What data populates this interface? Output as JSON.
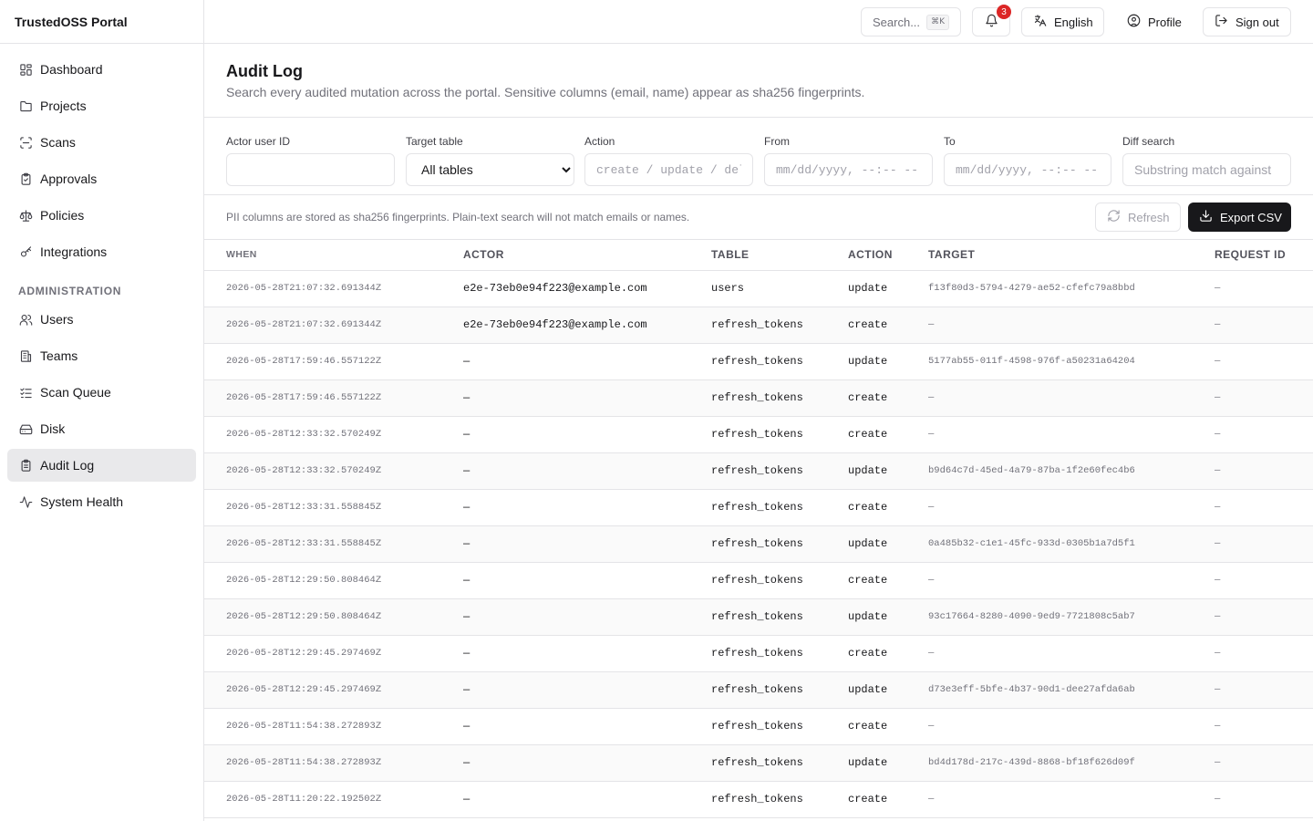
{
  "app": {
    "title": "TrustedOSS Portal"
  },
  "sidebar": {
    "items": [
      {
        "label": "Dashboard",
        "icon": "dashboard-icon"
      },
      {
        "label": "Projects",
        "icon": "folder-icon"
      },
      {
        "label": "Scans",
        "icon": "scan-icon"
      },
      {
        "label": "Approvals",
        "icon": "clipboard-check-icon"
      },
      {
        "label": "Policies",
        "icon": "scale-icon"
      },
      {
        "label": "Integrations",
        "icon": "key-icon"
      }
    ],
    "admin_section": "ADMINISTRATION",
    "admin_items": [
      {
        "label": "Users",
        "icon": "users-icon"
      },
      {
        "label": "Teams",
        "icon": "building-icon"
      },
      {
        "label": "Scan Queue",
        "icon": "list-check-icon"
      },
      {
        "label": "Disk",
        "icon": "hard-drive-icon"
      },
      {
        "label": "Audit Log",
        "icon": "clipboard-list-icon",
        "active": true
      },
      {
        "label": "System Health",
        "icon": "activity-icon"
      }
    ]
  },
  "topbar": {
    "search_label": "Search...",
    "search_shortcut": "⌘K",
    "notification_count": "3",
    "language": "English",
    "profile": "Profile",
    "sign_out": "Sign out"
  },
  "page": {
    "title": "Audit Log",
    "subtitle": "Search every audited mutation across the portal. Sensitive columns (email, name) appear as sha256 fingerprints."
  },
  "filters": {
    "actor_label": "Actor user ID",
    "actor_value": "",
    "table_label": "Target table",
    "table_value": "All tables",
    "action_label": "Action",
    "action_placeholder": "create / update / delete",
    "from_label": "From",
    "from_placeholder": "mm/dd/yyyy, --:-- --",
    "to_label": "To",
    "to_placeholder": "mm/dd/yyyy, --:-- --",
    "diff_label": "Diff search",
    "diff_placeholder": "Substring match against"
  },
  "toolbar": {
    "notice": "PII columns are stored as sha256 fingerprints. Plain-text search will not match emails or names.",
    "refresh": "Refresh",
    "export": "Export CSV"
  },
  "table": {
    "columns": [
      "WHEN",
      "ACTOR",
      "TABLE",
      "ACTION",
      "TARGET",
      "REQUEST ID"
    ],
    "rows": [
      [
        "2026-05-28T21:07:32.691344Z",
        "e2e-73eb0e94f223@example.com",
        "users",
        "update",
        "f13f80d3-5794-4279-ae52-cfefc79a8bbd",
        "—"
      ],
      [
        "2026-05-28T21:07:32.691344Z",
        "e2e-73eb0e94f223@example.com",
        "refresh_tokens",
        "create",
        "—",
        "—"
      ],
      [
        "2026-05-28T17:59:46.557122Z",
        "—",
        "refresh_tokens",
        "update",
        "5177ab55-011f-4598-976f-a50231a64204",
        "—"
      ],
      [
        "2026-05-28T17:59:46.557122Z",
        "—",
        "refresh_tokens",
        "create",
        "—",
        "—"
      ],
      [
        "2026-05-28T12:33:32.570249Z",
        "—",
        "refresh_tokens",
        "create",
        "—",
        "—"
      ],
      [
        "2026-05-28T12:33:32.570249Z",
        "—",
        "refresh_tokens",
        "update",
        "b9d64c7d-45ed-4a79-87ba-1f2e60fec4b6",
        "—"
      ],
      [
        "2026-05-28T12:33:31.558845Z",
        "—",
        "refresh_tokens",
        "create",
        "—",
        "—"
      ],
      [
        "2026-05-28T12:33:31.558845Z",
        "—",
        "refresh_tokens",
        "update",
        "0a485b32-c1e1-45fc-933d-0305b1a7d5f1",
        "—"
      ],
      [
        "2026-05-28T12:29:50.808464Z",
        "—",
        "refresh_tokens",
        "create",
        "—",
        "—"
      ],
      [
        "2026-05-28T12:29:50.808464Z",
        "—",
        "refresh_tokens",
        "update",
        "93c17664-8280-4090-9ed9-7721808c5ab7",
        "—"
      ],
      [
        "2026-05-28T12:29:45.297469Z",
        "—",
        "refresh_tokens",
        "create",
        "—",
        "—"
      ],
      [
        "2026-05-28T12:29:45.297469Z",
        "—",
        "refresh_tokens",
        "update",
        "d73e3eff-5bfe-4b37-90d1-dee27afda6ab",
        "—"
      ],
      [
        "2026-05-28T11:54:38.272893Z",
        "—",
        "refresh_tokens",
        "create",
        "—",
        "—"
      ],
      [
        "2026-05-28T11:54:38.272893Z",
        "—",
        "refresh_tokens",
        "update",
        "bd4d178d-217c-439d-8868-bf18f626d09f",
        "—"
      ],
      [
        "2026-05-28T11:20:22.192502Z",
        "—",
        "refresh_tokens",
        "create",
        "—",
        "—"
      ]
    ]
  }
}
